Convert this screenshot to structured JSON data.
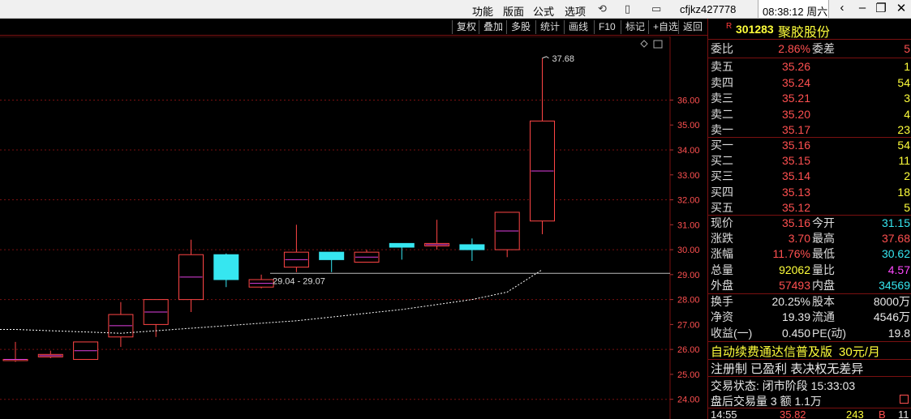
{
  "titlebar": {
    "menus": [
      "功能",
      "版面",
      "公式",
      "选项"
    ],
    "user": "cfjkz427778",
    "time": "08:38:12 周六"
  },
  "chart_toolbar": {
    "buttons": [
      "复权",
      "叠加",
      "多股",
      "统计",
      "画线",
      "F10",
      "标记",
      "+自选",
      "返回"
    ]
  },
  "chart_data": {
    "type": "candlestick",
    "ylim": [
      23.6,
      37.9
    ],
    "ytick_labels": [
      "24.00",
      "25.00",
      "26.00",
      "27.00",
      "28.00",
      "29.00",
      "30.00",
      "31.00",
      "32.00",
      "33.00",
      "34.00",
      "35.00",
      "36.00"
    ],
    "candles": [
      {
        "open": 25.6,
        "high": 26.3,
        "low": 25.5,
        "close": 25.6,
        "dir": "up"
      },
      {
        "open": 25.7,
        "high": 25.95,
        "low": 25.65,
        "close": 25.8,
        "dir": "up"
      },
      {
        "open": 25.6,
        "high": 26.3,
        "low": 25.6,
        "close": 26.3,
        "dir": "up"
      },
      {
        "open": 26.5,
        "high": 27.9,
        "low": 26.1,
        "close": 27.4,
        "dir": "up"
      },
      {
        "open": 27.0,
        "high": 28.0,
        "low": 26.5,
        "close": 28.0,
        "dir": "up"
      },
      {
        "open": 28.0,
        "high": 30.4,
        "low": 27.5,
        "close": 29.8,
        "dir": "up"
      },
      {
        "open": 29.8,
        "high": 29.85,
        "low": 28.5,
        "close": 28.8,
        "dir": "down"
      },
      {
        "open": 28.5,
        "high": 29.0,
        "low": 28.45,
        "close": 28.8,
        "dir": "up"
      },
      {
        "open": 29.3,
        "high": 31.0,
        "low": 29.1,
        "close": 29.9,
        "dir": "up"
      },
      {
        "open": 29.9,
        "high": 29.9,
        "low": 29.1,
        "close": 29.6,
        "dir": "down"
      },
      {
        "open": 29.5,
        "high": 30.0,
        "low": 29.5,
        "close": 29.9,
        "dir": "up"
      },
      {
        "open": 30.25,
        "high": 30.25,
        "low": 29.6,
        "close": 30.1,
        "dir": "down"
      },
      {
        "open": 30.15,
        "high": 31.2,
        "low": 30.0,
        "close": 30.25,
        "dir": "up"
      },
      {
        "open": 30.2,
        "high": 30.45,
        "low": 29.55,
        "close": 30.0,
        "dir": "down"
      },
      {
        "open": 30.0,
        "high": 31.5,
        "low": 29.7,
        "close": 31.5,
        "dir": "up"
      },
      {
        "open": 31.15,
        "high": 37.68,
        "low": 30.62,
        "close": 35.16,
        "dir": "up"
      }
    ],
    "ma_line": [
      26.8,
      26.75,
      26.7,
      26.65,
      26.75,
      26.85,
      26.95,
      27.05,
      27.15,
      27.3,
      27.45,
      27.6,
      27.8,
      28.0,
      28.3,
      29.2
    ],
    "max_label": "37.68",
    "range_label": "29.04 - 29.07",
    "range_level": 29.05
  },
  "stock": {
    "flag": "R",
    "code": "301283",
    "name": "聚胶股份"
  },
  "weibi": {
    "label": "委比",
    "value": "2.86%",
    "label2": "委差",
    "value2": "5"
  },
  "sell": [
    {
      "label": "卖五",
      "price": "35.26",
      "vol": "1"
    },
    {
      "label": "卖四",
      "price": "35.24",
      "vol": "54"
    },
    {
      "label": "卖三",
      "price": "35.21",
      "vol": "3"
    },
    {
      "label": "卖二",
      "price": "35.20",
      "vol": "4"
    },
    {
      "label": "卖一",
      "price": "35.17",
      "vol": "23"
    }
  ],
  "buy": [
    {
      "label": "买一",
      "price": "35.16",
      "vol": "54"
    },
    {
      "label": "买二",
      "price": "35.15",
      "vol": "11"
    },
    {
      "label": "买三",
      "price": "35.14",
      "vol": "2"
    },
    {
      "label": "买四",
      "price": "35.13",
      "vol": "18"
    },
    {
      "label": "买五",
      "price": "35.12",
      "vol": "5"
    }
  ],
  "quote": [
    {
      "l1": "现价",
      "v1": "35.16",
      "l2": "今开",
      "v2": "31.15"
    },
    {
      "l1": "涨跌",
      "v1": "3.70",
      "l2": "最高",
      "v2": "37.68"
    },
    {
      "l1": "涨幅",
      "v1": "11.76%",
      "l2": "最低",
      "v2": "30.62"
    },
    {
      "l1": "总量",
      "v1": "92062",
      "l2": "量比",
      "v2": "4.57"
    },
    {
      "l1": "外盘",
      "v1": "57493",
      "l2": "内盘",
      "v2": "34569"
    }
  ],
  "fundamentals": [
    {
      "l1": "换手",
      "v1": "20.25%",
      "l2": "股本",
      "v2": "8000万"
    },
    {
      "l1": "净资",
      "v1": "19.39",
      "l2": "流通",
      "v2": "4546万"
    },
    {
      "l1": "收益(一)",
      "v1": "0.450",
      "l2": "PE(动)",
      "v2": "19.8"
    }
  ],
  "promo": {
    "text": "自动续费通达信普及版",
    "price": "30元/月"
  },
  "notice": "注册制 已盈利 表决权无差异",
  "trade_status": "交易状态: 闭市阶段 15:33:03",
  "after_hours": "盘后交易量 3 额 1.1万",
  "last_tick": {
    "time": "14:55",
    "price": "35.82",
    "vol": "243",
    "side": "B",
    "count": "11"
  }
}
